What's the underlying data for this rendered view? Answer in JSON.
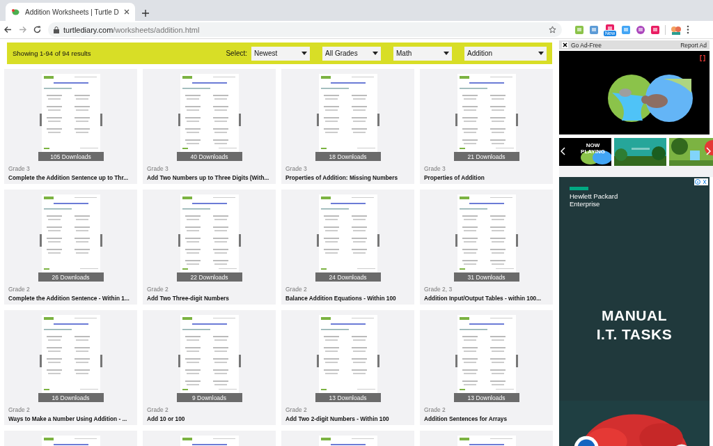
{
  "browser": {
    "tab_title": "Addition Worksheets | Turtle D",
    "url_domain": "turtlediary.com",
    "url_path": "/worksheets/addition.html",
    "extension_badge": "New"
  },
  "filter_bar": {
    "results": "Showing 1-94 of 94 results",
    "select_label": "Select:",
    "dropdowns": [
      {
        "value": "Newest"
      },
      {
        "value": "All Grades"
      },
      {
        "value": "Math"
      },
      {
        "value": "Addition"
      }
    ]
  },
  "cards": [
    {
      "downloads": "105 Downloads",
      "grade": "Grade 3",
      "title": "Complete the Addition Sentence up to Thr..."
    },
    {
      "downloads": "40 Downloads",
      "grade": "Grade 3",
      "title": "Add Two Numbers up to Three Digits (With..."
    },
    {
      "downloads": "18 Downloads",
      "grade": "Grade 3",
      "title": "Properties of Addition: Missing Numbers"
    },
    {
      "downloads": "21 Downloads",
      "grade": "Grade 3",
      "title": "Properties of Addition"
    },
    {
      "downloads": "26 Downloads",
      "grade": "Grade 2",
      "title": "Complete the Addition Sentence - Within 1..."
    },
    {
      "downloads": "22 Downloads",
      "grade": "Grade 2",
      "title": "Add Two Three-digit Numbers"
    },
    {
      "downloads": "24 Downloads",
      "grade": "Grade 2",
      "title": "Balance Addition Equations - Within 100"
    },
    {
      "downloads": "31 Downloads",
      "grade": "Grade 2, 3",
      "title": "Addition Input/Output Tables - within 100..."
    },
    {
      "downloads": "16 Downloads",
      "grade": "Grade 2",
      "title": "Ways to Make a Number Using Addition - ..."
    },
    {
      "downloads": "9 Downloads",
      "grade": "Grade 2",
      "title": "Add 10 or 100"
    },
    {
      "downloads": "13 Downloads",
      "grade": "Grade 2",
      "title": "Add Two 2-digit Numbers - Within 100"
    },
    {
      "downloads": "13 Downloads",
      "grade": "Grade 2",
      "title": "Addition Sentences for Arrays"
    }
  ],
  "ad_panel": {
    "go_ad_free": "Go Ad-Free",
    "report": "Report Ad",
    "now_playing": "NOW PLAYING",
    "banner": {
      "brand_lines": [
        "Hewlett Packard",
        "Enterprise"
      ],
      "headline_lines": [
        "MANUAL",
        "I.T. TASKS"
      ]
    }
  }
}
